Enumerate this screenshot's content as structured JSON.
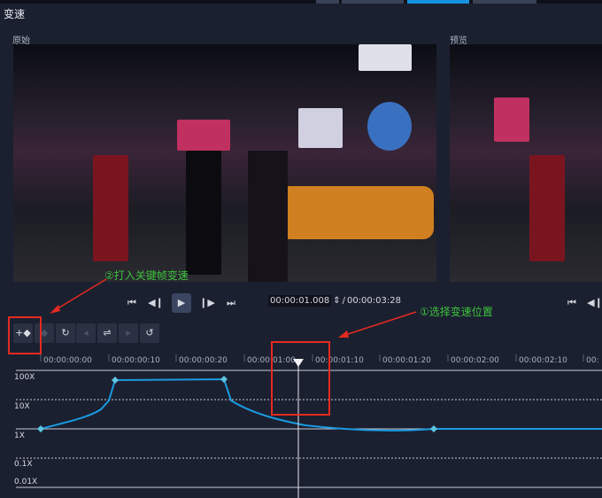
{
  "panel": {
    "title": "变速"
  },
  "original": {
    "label": "原始"
  },
  "preview": {
    "label": "预览"
  },
  "playback": {
    "current_time": "00:00:01.008",
    "separator": "/",
    "total_time": "00:00:03:28"
  },
  "annotations": {
    "step1": "①选择变速位置",
    "step2": "②打入关键帧变速"
  },
  "toolbar": {
    "buttons": [
      "add-keyframe",
      "remove-keyframe",
      "reset-keyframes",
      "prev-keyframe",
      "flip-keyframe",
      "next-keyframe",
      "ease-keyframe"
    ]
  },
  "timeline": {
    "ticks": [
      "00:00:00:00",
      "00:00:00:10",
      "00:00:00:20",
      "00:00:01:00",
      "00:00:01:10",
      "00:00:01:20",
      "00:00:02:00",
      "00:00:02:10",
      "00:"
    ]
  },
  "speed_axis": {
    "labels": [
      "100X",
      "10X",
      "1X",
      "0.1X",
      "0.01X"
    ]
  },
  "colors": {
    "curve": "#1a9be0",
    "annotation_box": "#e52a20",
    "annotation_text": "#3dc23d",
    "active_tab": "#1593e0"
  }
}
